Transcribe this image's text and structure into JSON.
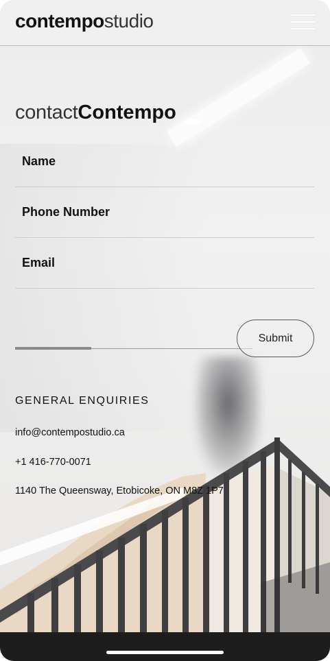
{
  "header": {
    "logo_bold": "contempo",
    "logo_light": "studio"
  },
  "contact": {
    "title_light": "contact",
    "title_bold": "Contempo"
  },
  "form": {
    "name_placeholder": "Name",
    "phone_placeholder": "Phone Number",
    "email_placeholder": "Email",
    "submit_label": "Submit",
    "progress_fraction": 0.32
  },
  "enquiries": {
    "title": "GENERAL ENQUIRIES",
    "email": "info@contempostudio.ca",
    "phone": "+1 416-770-0071",
    "address": "1140 The Queensway, Etobicoke, ON M8Z 1P7"
  },
  "icons": {
    "menu": "hamburger-menu-icon"
  },
  "colors": {
    "text": "#111111",
    "bottom_bar": "#1d1d1d",
    "divider": "#cdcdcd"
  }
}
